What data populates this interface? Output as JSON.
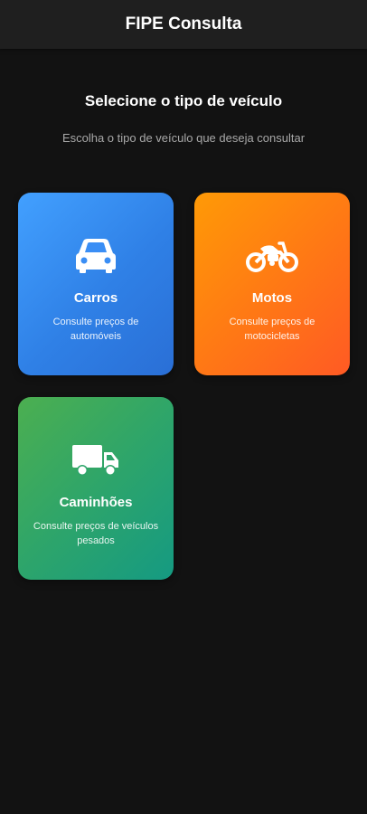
{
  "app_bar": {
    "title": "FIPE Consulta"
  },
  "main": {
    "heading": "Selecione o tipo de veículo",
    "subheading": "Escolha o tipo de veículo que deseja consultar",
    "cards": [
      {
        "title": "Carros",
        "description": "Consulte preços de automóveis",
        "icon": "car-icon",
        "color": "#3a8ef5"
      },
      {
        "title": "Motos",
        "description": "Consulte preços de motocicletas",
        "icon": "motorcycle-icon",
        "color": "#ff7a14"
      },
      {
        "title": "Caminhões",
        "description": "Consulte preços de veículos pesados",
        "icon": "truck-icon",
        "color": "#2ea56a"
      }
    ]
  }
}
